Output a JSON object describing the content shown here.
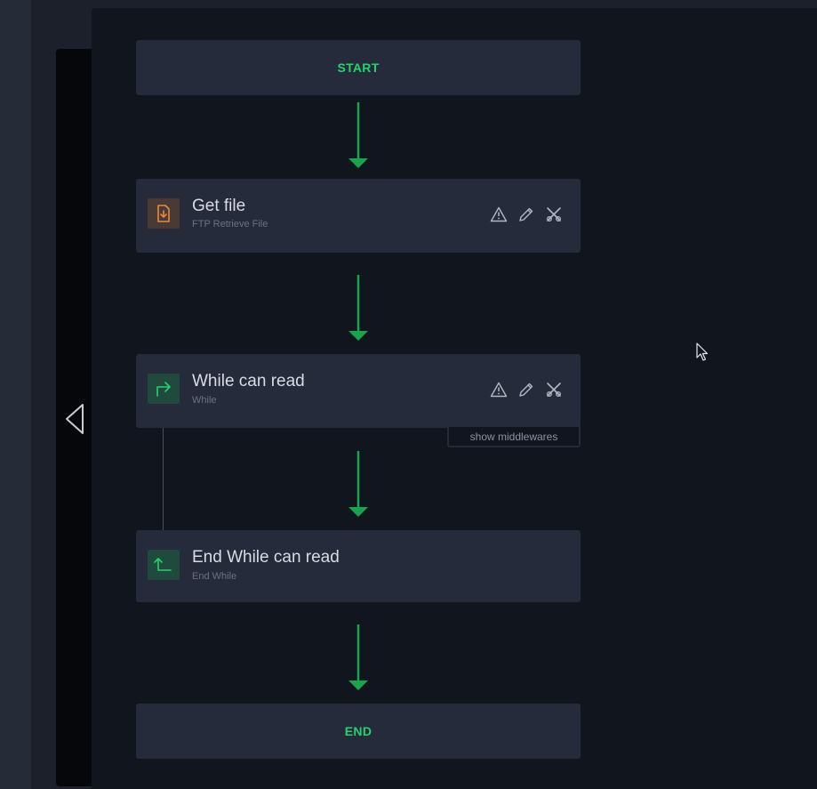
{
  "flow": {
    "start_label": "START",
    "end_label": "END",
    "steps": [
      {
        "title": "Get file",
        "subtitle": "FTP Retrieve File",
        "icon": "file-download-icon"
      },
      {
        "title": "While can read",
        "subtitle": "While",
        "icon": "loop-start-icon"
      },
      {
        "title": "End While can read",
        "subtitle": "End While",
        "icon": "loop-end-icon"
      }
    ],
    "show_middlewares_label": "show middlewares"
  },
  "colors": {
    "accent_green": "#22d46b",
    "arrow_green": "#17a54e",
    "orange_icon": "#e88a3a"
  }
}
